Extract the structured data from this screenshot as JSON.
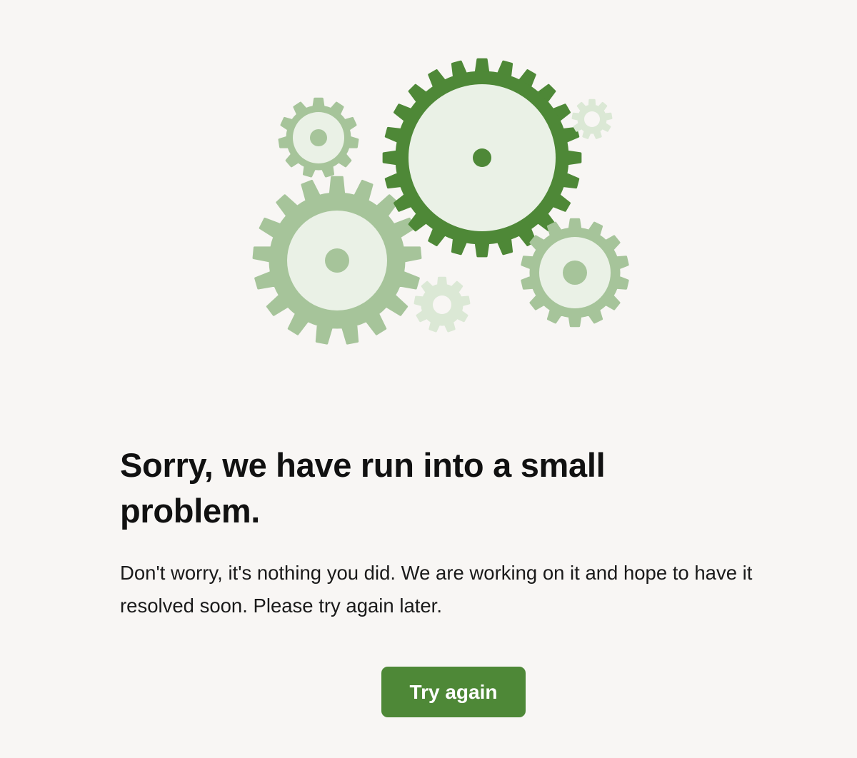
{
  "error": {
    "heading": "Sorry, we have run into a small problem.",
    "message": "Don't worry, it's nothing you did. We are working on it and hope to have it resolved soon. Please try again later.",
    "retry_label": "Try again"
  },
  "illustration": {
    "icon": "gears-icon",
    "gears": [
      {
        "name": "large-light-gear-icon",
        "color": "#a6c49a",
        "hub": "#eaf1e6",
        "dot": "#a6c49a"
      },
      {
        "name": "main-dark-gear-icon",
        "color": "#4e8837",
        "hub": "#eaf1e6",
        "dot": "#4e8837"
      },
      {
        "name": "top-left-small-gear-icon",
        "color": "#a6c49a",
        "hub": "#eaf1e6",
        "dot": "#a6c49a"
      },
      {
        "name": "bottom-right-gear-icon",
        "color": "#a6c49a",
        "hub": "#eaf1e6",
        "dot": "#a6c49a"
      },
      {
        "name": "tiny-top-right-gear-icon",
        "color": "#dbe8d5",
        "hub": "#f8f6f4",
        "dot": null
      },
      {
        "name": "tiny-center-gear-icon",
        "color": "#dbe8d5",
        "hub": "#f8f6f4",
        "dot": null
      }
    ]
  },
  "colors": {
    "accent": "#4e8837",
    "background": "#f8f6f4",
    "text": "#111111"
  }
}
